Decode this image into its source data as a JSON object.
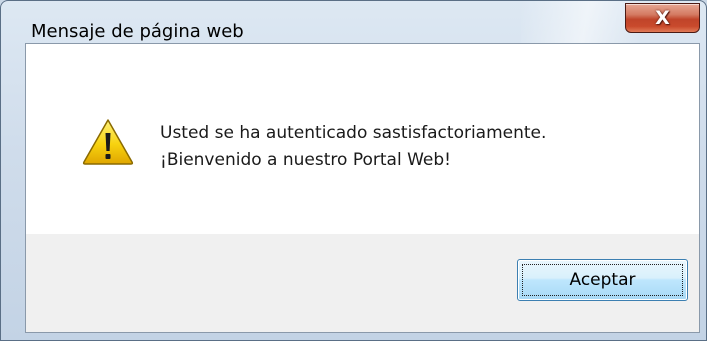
{
  "window": {
    "title": "Mensaje de página web",
    "close_icon": "X"
  },
  "dialog": {
    "icon": "warning-icon",
    "message_line_1": "Usted se ha autenticado sastisfactoriamente.",
    "message_line_2": "¡Bienvenido a nuestro Portal Web!",
    "ok_label": "Aceptar"
  },
  "colors": {
    "frame": "#cfdceb",
    "close_button": "#c94a2c",
    "content_bg": "#ffffff",
    "footer_bg": "#f0f0f0",
    "ok_border": "#3c7fb1",
    "warning_yellow": "#f7d20f"
  }
}
